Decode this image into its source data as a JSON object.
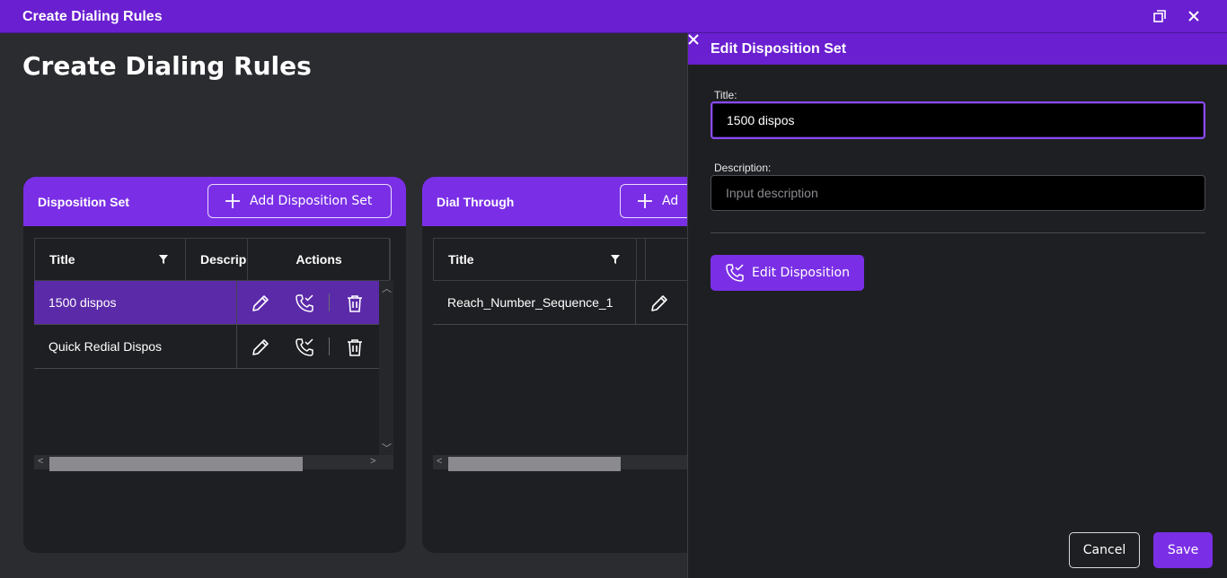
{
  "window": {
    "title": "Create Dialing Rules"
  },
  "page": {
    "title": "Create Dialing Rules"
  },
  "disposition_card": {
    "label": "Disposition Set",
    "add_label": "Add Disposition Set",
    "columns": [
      "Title",
      "Descrip",
      "Actions"
    ],
    "rows": [
      {
        "title": "1500 dispos",
        "selected": true
      },
      {
        "title": "Quick Redial Dispos",
        "selected": false
      }
    ]
  },
  "dial_card": {
    "label": "Dial Through",
    "add_label": "Ad",
    "columns": [
      "Title"
    ],
    "rows": [
      {
        "title": "Reach_Number_Sequence_1"
      }
    ]
  },
  "panel": {
    "title": "Edit Disposition Set",
    "title_label": "Title:",
    "title_value": "1500 dispos",
    "description_label": "Description:",
    "description_placeholder": "Input description",
    "edit_disposition_label": "Edit Disposition",
    "cancel_label": "Cancel",
    "save_label": "Save"
  },
  "colors": {
    "accent": "#7a2fe6",
    "titlebar": "#6a1fd0",
    "selected_row": "#5b2aa8",
    "background": "#2b2c30",
    "card": "#1e1f22"
  },
  "icons": [
    "restore-icon",
    "close-icon",
    "plus-icon",
    "filter-icon",
    "pencil-icon",
    "phone-check-icon",
    "trash-icon"
  ]
}
